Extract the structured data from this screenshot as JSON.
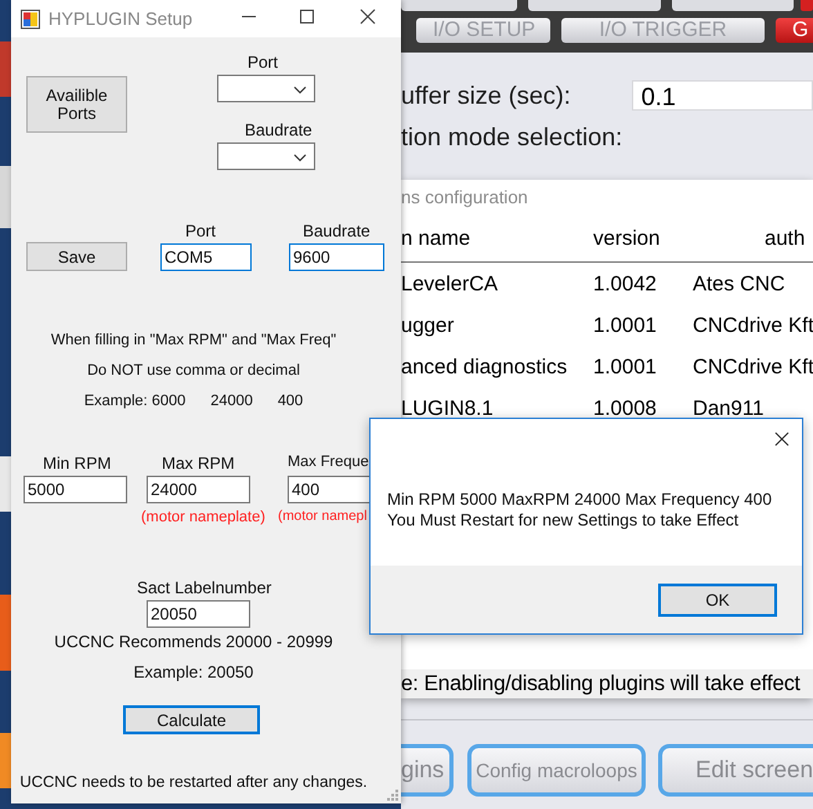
{
  "background_app": {
    "tabs_row_2": [
      {
        "label": "I/O SETUP",
        "kind": "normal"
      },
      {
        "label": "I/O  TRIGGER",
        "kind": "normal"
      },
      {
        "label": "G",
        "kind": "alert"
      }
    ],
    "buffer_label": "uffer size (sec):",
    "buffer_value": "0.1",
    "mode_label": "tion mode selection:",
    "bottom_buttons": [
      "gins",
      "Config  macroloops",
      "Edit screen"
    ]
  },
  "plugins_window": {
    "title": "ns configuration",
    "columns": [
      "n name",
      "version",
      "auth"
    ],
    "rows": [
      [
        "LevelerCA",
        "1.0042",
        "Ates CNC"
      ],
      [
        "ugger",
        "1.0001",
        "CNCdrive Kft"
      ],
      [
        "anced diagnostics",
        "1.0001",
        "CNCdrive Kft"
      ],
      [
        "LUGIN8.1",
        "1.0008",
        "Dan911"
      ]
    ],
    "note": "e: Enabling/disabling plugins will take effect"
  },
  "setup_window": {
    "title": "HYPLUGIN Setup",
    "available_ports_button": "Availible Ports",
    "port_label": "Port",
    "baudrate_label": "Baudrate",
    "save_button": "Save",
    "port_field": {
      "label": "Port",
      "value": "COM5",
      "highlighted": true
    },
    "baudrate_field": {
      "label": "Baudrate",
      "value": "9600",
      "highlighted": true
    },
    "hints": [
      "When filling in \"Max RPM\" and \"Max Freq\"",
      "Do NOT use comma or decimal"
    ],
    "example_values": [
      "Example: 6000",
      "24000",
      "400"
    ],
    "rpm_fields": [
      {
        "label": "Min RPM",
        "value": "5000",
        "highlighted": false
      },
      {
        "label": "Max RPM",
        "value": "24000",
        "note": "(motor nameplate)",
        "highlighted": false
      },
      {
        "label": "Max Freque",
        "value": "400",
        "note": "(motor namepl",
        "highlighted": false
      }
    ],
    "label_field": {
      "label": "Sact Labelnumber",
      "value": "20050",
      "highlighted": false
    },
    "recommendation": "UCCNC Recommends 20000 - 20999",
    "example": "Example:  20050",
    "calculate_button": {
      "label": "Calculate",
      "highlighted": true
    },
    "footer": "UCCNC needs to be restarted after any changes."
  },
  "message_box": {
    "lines": [
      "Min RPM 5000 MaxRPM 24000 Max Frequency 400",
      "You Must Restart for new Settings to take Effect"
    ],
    "ok_button": {
      "label": "OK",
      "highlighted": true
    }
  }
}
